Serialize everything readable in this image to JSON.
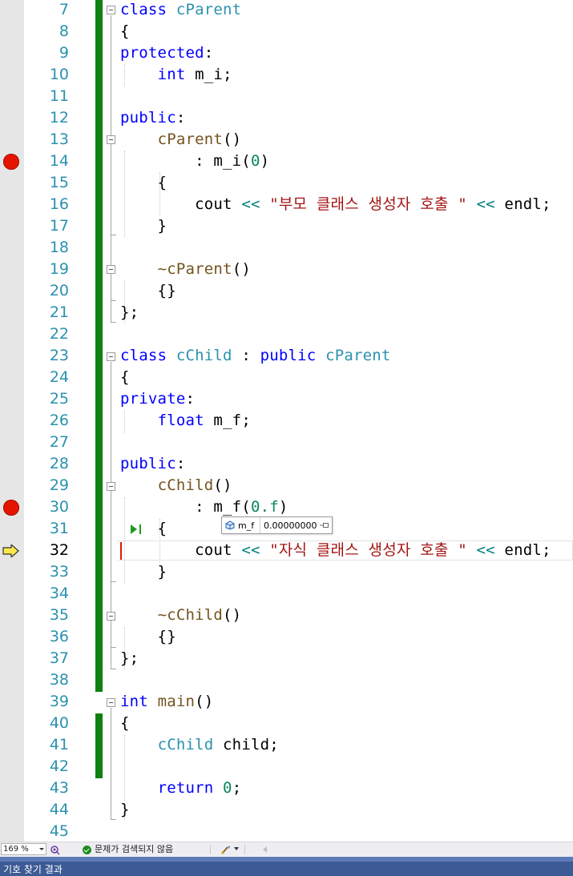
{
  "editor": {
    "first_line_number": 7,
    "current_line": 32,
    "breakpoint_lines": [
      14,
      30
    ],
    "lines": [
      {
        "n": "7",
        "tokens": [
          {
            "t": "class ",
            "c": "kw"
          },
          {
            "t": "cParent",
            "c": "ty"
          }
        ]
      },
      {
        "n": "8",
        "tokens": [
          {
            "t": "{",
            "c": ""
          }
        ]
      },
      {
        "n": "9",
        "tokens": [
          {
            "t": "protected",
            "c": "kw"
          },
          {
            "t": ":",
            "c": ""
          }
        ]
      },
      {
        "n": "10",
        "tokens": [
          {
            "t": "    ",
            "c": ""
          },
          {
            "t": "int",
            "c": "kw"
          },
          {
            "t": " m_i;",
            "c": ""
          }
        ]
      },
      {
        "n": "11",
        "tokens": []
      },
      {
        "n": "12",
        "tokens": [
          {
            "t": "public",
            "c": "kw"
          },
          {
            "t": ":",
            "c": ""
          }
        ]
      },
      {
        "n": "13",
        "tokens": [
          {
            "t": "    ",
            "c": ""
          },
          {
            "t": "cParent",
            "c": "fn"
          },
          {
            "t": "()",
            "c": ""
          }
        ]
      },
      {
        "n": "14",
        "tokens": [
          {
            "t": "        : m_i(",
            "c": ""
          },
          {
            "t": "0",
            "c": "num"
          },
          {
            "t": ")",
            "c": ""
          }
        ]
      },
      {
        "n": "15",
        "tokens": [
          {
            "t": "    {",
            "c": ""
          }
        ]
      },
      {
        "n": "16",
        "tokens": [
          {
            "t": "        cout ",
            "c": ""
          },
          {
            "t": "<<",
            "c": "op"
          },
          {
            "t": " ",
            "c": ""
          },
          {
            "t": "\"부모 클래스 생성자 호출 \"",
            "c": "str"
          },
          {
            "t": " ",
            "c": ""
          },
          {
            "t": "<<",
            "c": "op"
          },
          {
            "t": " endl;",
            "c": ""
          }
        ]
      },
      {
        "n": "17",
        "tokens": [
          {
            "t": "    }",
            "c": ""
          }
        ]
      },
      {
        "n": "18",
        "tokens": []
      },
      {
        "n": "19",
        "tokens": [
          {
            "t": "    ",
            "c": ""
          },
          {
            "t": "~cParent",
            "c": "fn"
          },
          {
            "t": "()",
            "c": ""
          }
        ]
      },
      {
        "n": "20",
        "tokens": [
          {
            "t": "    {}",
            "c": ""
          }
        ]
      },
      {
        "n": "21",
        "tokens": [
          {
            "t": "};",
            "c": ""
          }
        ]
      },
      {
        "n": "22",
        "tokens": []
      },
      {
        "n": "23",
        "tokens": [
          {
            "t": "class ",
            "c": "kw"
          },
          {
            "t": "cChild",
            "c": "ty"
          },
          {
            "t": " : ",
            "c": ""
          },
          {
            "t": "public ",
            "c": "kw"
          },
          {
            "t": "cParent",
            "c": "ty"
          }
        ]
      },
      {
        "n": "24",
        "tokens": [
          {
            "t": "{",
            "c": ""
          }
        ]
      },
      {
        "n": "25",
        "tokens": [
          {
            "t": "private",
            "c": "kw"
          },
          {
            "t": ":",
            "c": ""
          }
        ]
      },
      {
        "n": "26",
        "tokens": [
          {
            "t": "    ",
            "c": ""
          },
          {
            "t": "float",
            "c": "kw"
          },
          {
            "t": " m_f;",
            "c": ""
          }
        ]
      },
      {
        "n": "27",
        "tokens": []
      },
      {
        "n": "28",
        "tokens": [
          {
            "t": "public",
            "c": "kw"
          },
          {
            "t": ":",
            "c": ""
          }
        ]
      },
      {
        "n": "29",
        "tokens": [
          {
            "t": "    ",
            "c": ""
          },
          {
            "t": "cChild",
            "c": "fn"
          },
          {
            "t": "()",
            "c": ""
          }
        ]
      },
      {
        "n": "30",
        "tokens": [
          {
            "t": "        : m_f(",
            "c": ""
          },
          {
            "t": "0.f",
            "c": "num"
          },
          {
            "t": ")",
            "c": ""
          }
        ]
      },
      {
        "n": "31",
        "tokens": [
          {
            "t": "    {",
            "c": ""
          }
        ]
      },
      {
        "n": "32",
        "tokens": [
          {
            "t": "        cout ",
            "c": ""
          },
          {
            "t": "<<",
            "c": "op"
          },
          {
            "t": " ",
            "c": ""
          },
          {
            "t": "\"자식 클래스 생성자 호출 \"",
            "c": "str"
          },
          {
            "t": " ",
            "c": ""
          },
          {
            "t": "<<",
            "c": "op"
          },
          {
            "t": " endl;",
            "c": ""
          }
        ]
      },
      {
        "n": "33",
        "tokens": [
          {
            "t": "    }",
            "c": ""
          }
        ]
      },
      {
        "n": "34",
        "tokens": []
      },
      {
        "n": "35",
        "tokens": [
          {
            "t": "    ",
            "c": ""
          },
          {
            "t": "~cChild",
            "c": "fn"
          },
          {
            "t": "()",
            "c": ""
          }
        ]
      },
      {
        "n": "36",
        "tokens": [
          {
            "t": "    {}",
            "c": ""
          }
        ]
      },
      {
        "n": "37",
        "tokens": [
          {
            "t": "};",
            "c": ""
          }
        ]
      },
      {
        "n": "38",
        "tokens": []
      },
      {
        "n": "39",
        "tokens": [
          {
            "t": "int ",
            "c": "kw"
          },
          {
            "t": "main",
            "c": "fn"
          },
          {
            "t": "()",
            "c": ""
          }
        ]
      },
      {
        "n": "40",
        "tokens": [
          {
            "t": "{",
            "c": ""
          }
        ]
      },
      {
        "n": "41",
        "tokens": [
          {
            "t": "    ",
            "c": ""
          },
          {
            "t": "cChild",
            "c": "ty"
          },
          {
            "t": " child;",
            "c": ""
          }
        ]
      },
      {
        "n": "42",
        "tokens": []
      },
      {
        "n": "43",
        "tokens": [
          {
            "t": "    ",
            "c": ""
          },
          {
            "t": "return ",
            "c": "kw"
          },
          {
            "t": "0",
            "c": "num"
          },
          {
            "t": ";",
            "c": ""
          }
        ]
      },
      {
        "n": "44",
        "tokens": [
          {
            "t": "}",
            "c": ""
          }
        ]
      },
      {
        "n": "45",
        "tokens": []
      }
    ]
  },
  "datatip": {
    "name": "m_f",
    "value": "0.00000000",
    "icon": "field-icon"
  },
  "status_bar": {
    "zoom": "169 %",
    "issues": "문제가 검색되지 않음"
  },
  "bottom_panel": {
    "title": "기호 찾기 결과"
  },
  "colors": {
    "keyword": "#0000ff",
    "type": "#2b91af",
    "function": "#74531f",
    "string": "#a31515",
    "number": "#098658",
    "operator": "#008080",
    "change_bar": "#108010",
    "breakpoint": "#e51400",
    "panel": "#3c5a94"
  }
}
